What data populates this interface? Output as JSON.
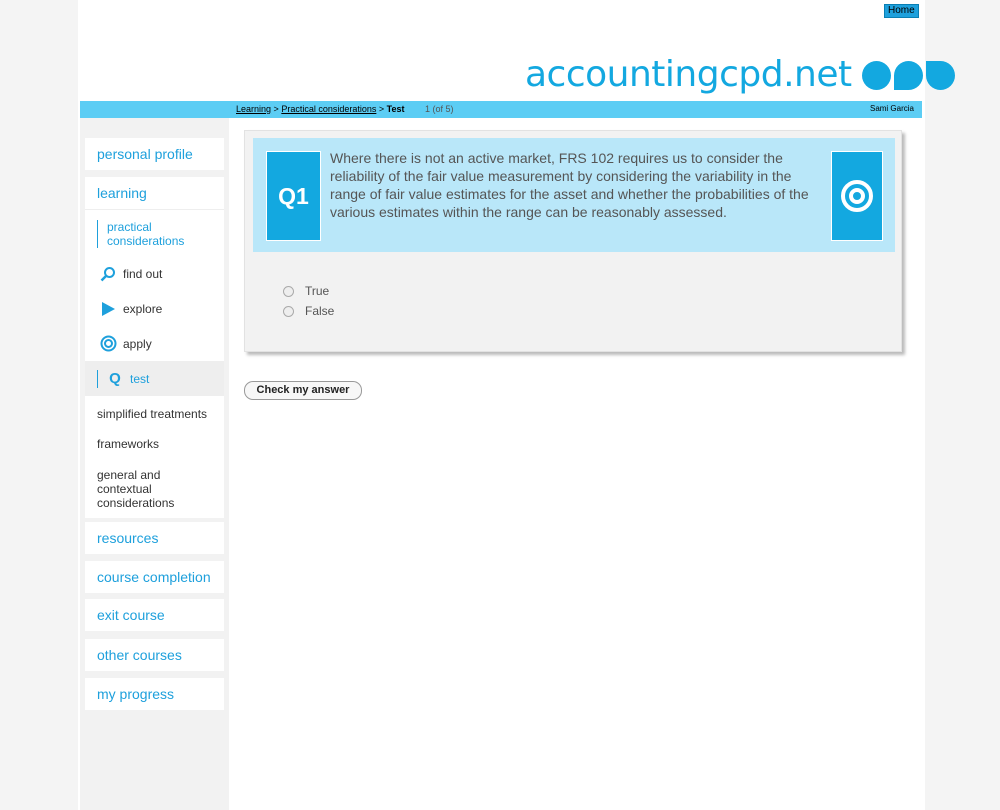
{
  "header": {
    "home_label": "Home",
    "logo_text": "accountingcpd.net",
    "brand_color": "#13a8e0"
  },
  "breadcrumb": {
    "items": [
      "Learning",
      "Practical considerations"
    ],
    "separator": ">",
    "current": "Test",
    "progress": "1 (of 5)"
  },
  "user": {
    "name": "Sami Garcia"
  },
  "sidebar": {
    "personal_profile": "personal profile",
    "learning": "learning",
    "practical": "practical considerations",
    "stages": [
      {
        "label": "find out",
        "icon": "magnifier-icon"
      },
      {
        "label": "explore",
        "icon": "play-icon"
      },
      {
        "label": "apply",
        "icon": "target-icon"
      },
      {
        "label": "test",
        "icon": "q-icon"
      }
    ],
    "subitems": [
      "simplified treatments",
      "frameworks",
      "general and contextual considerations"
    ],
    "bottom": [
      "resources",
      "course completion",
      "exit course",
      "other courses",
      "my progress"
    ]
  },
  "question": {
    "number": "Q1",
    "text": "Where there is not an active market, FRS 102 requires us to consider the reliability of the fair value measurement by considering the variability in the range of fair value estimates for the asset and whether the probabilities of the various estimates within the range can be reasonably assessed.",
    "icon": "target-icon",
    "options": [
      "True",
      "False"
    ]
  },
  "actions": {
    "check_label": "Check my answer"
  }
}
